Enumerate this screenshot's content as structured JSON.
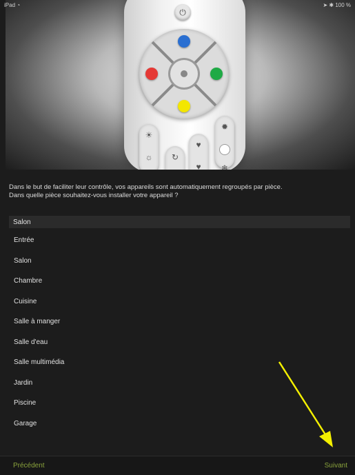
{
  "status": {
    "device": "iPad",
    "wifi_icon": "wifi-icon",
    "battery": "100 %"
  },
  "question": {
    "line1": "Dans le but de faciliter leur contrôle, vos appareils sont automatiquement regroupés par pièce.",
    "line2": "Dans quelle pièce souhaitez-vous installer votre appareil ?"
  },
  "room_picker": {
    "selected": "Salon",
    "options": [
      "Entrée",
      "Salon",
      "Chambre",
      "Cuisine",
      "Salle à manger",
      "Salle d'eau",
      "Salle multimédia",
      "Jardin",
      "Piscine",
      "Garage"
    ]
  },
  "footer": {
    "previous_label": "Précédent",
    "next_label": "Suivant"
  },
  "colors": {
    "accent": "#8aa33c",
    "background": "#1c1c1c",
    "arrow": "#f4f000",
    "dpad_up": "#2a6fd1",
    "dpad_left": "#e53935",
    "dpad_right": "#1faa45",
    "dpad_down": "#f3e600"
  }
}
